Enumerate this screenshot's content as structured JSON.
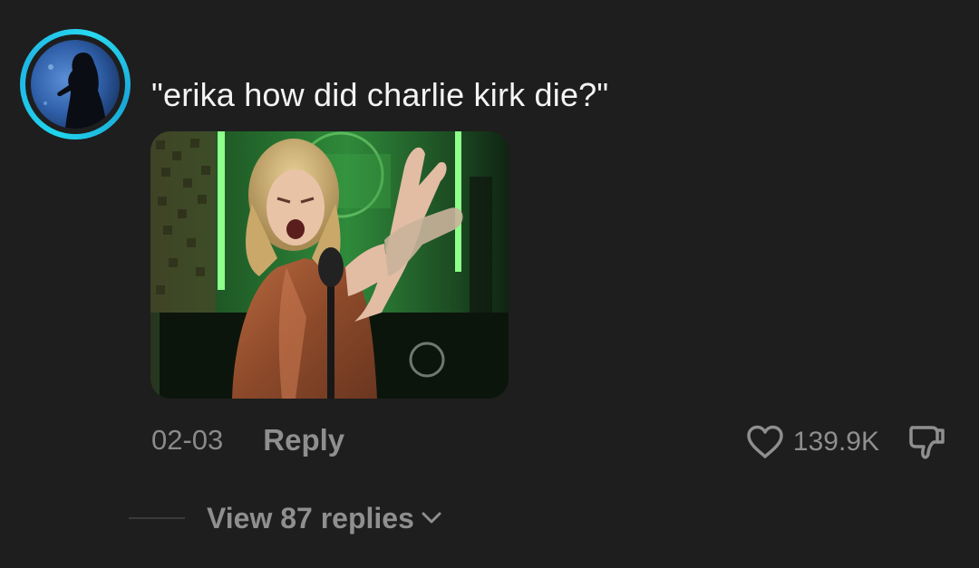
{
  "comment": {
    "text": "\"erika how did charlie kirk die?\"",
    "timestamp": "02-03",
    "reply_label": "Reply",
    "like_count": "139.9K",
    "view_replies_label": "View 87 replies"
  },
  "icons": {
    "like": "heart-outline-icon",
    "dislike": "thumbs-down-outline-icon",
    "expand": "chevron-down-icon"
  },
  "colors": {
    "background": "#1e1e1e",
    "primary_text": "#f4f4f4",
    "secondary_text": "#8f8f8f",
    "avatar_ring": "#20d5ec"
  }
}
